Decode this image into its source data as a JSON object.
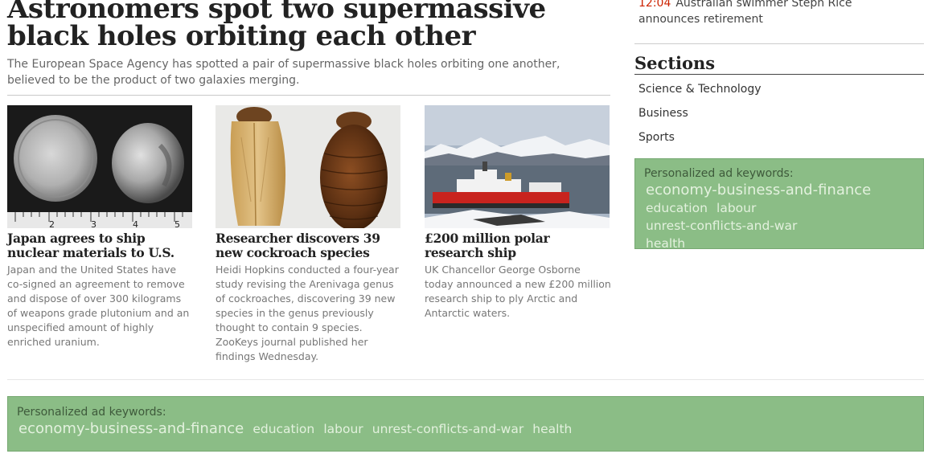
{
  "article": {
    "title": "Astronomers spot two supermassive black holes orbiting each other",
    "summary": "The European Space Agency has spotted a pair of supermassive black holes orbiting one another, believed to be the product of two galaxies merging."
  },
  "stories": [
    {
      "title": "Japan agrees to ship nuclear materials to U.S.",
      "body": "Japan and the United States have co-signed an agreement to remove and dispose of over 300 kilograms of weapons grade plutonium and an unspecified amount of highly enriched uranium."
    },
    {
      "title": "Researcher discovers 39 new cockroach species",
      "body": "Heidi Hopkins conducted a four-year study revising the Arenivaga genus of cockroaches, discovering 39 new species in the genus previously thought to contain 9 species. ZooKeys journal published her findings Wednesday."
    },
    {
      "title": "£200 million polar research ship",
      "body": "UK Chancellor George Osborne today announced a new £200 million research ship to ply Arctic and Antarctic waters."
    }
  ],
  "ruler_numbers": [
    "2",
    "3",
    "4",
    "5"
  ],
  "sidebar": {
    "ticker": {
      "time": "12:04",
      "text": "Australian swimmer Steph Rice announces retirement"
    },
    "sections_title": "Sections",
    "sections": [
      "Science & Technology",
      "Business",
      "Sports"
    ]
  },
  "ads": {
    "label": "Personalized ad keywords:",
    "keywords": [
      "economy-business-and-finance",
      "education",
      "labour",
      "unrest-conflicts-and-war",
      "health"
    ]
  },
  "colors": {
    "ad_background": "#8bbd86",
    "ticker_time": "#cc2200"
  }
}
